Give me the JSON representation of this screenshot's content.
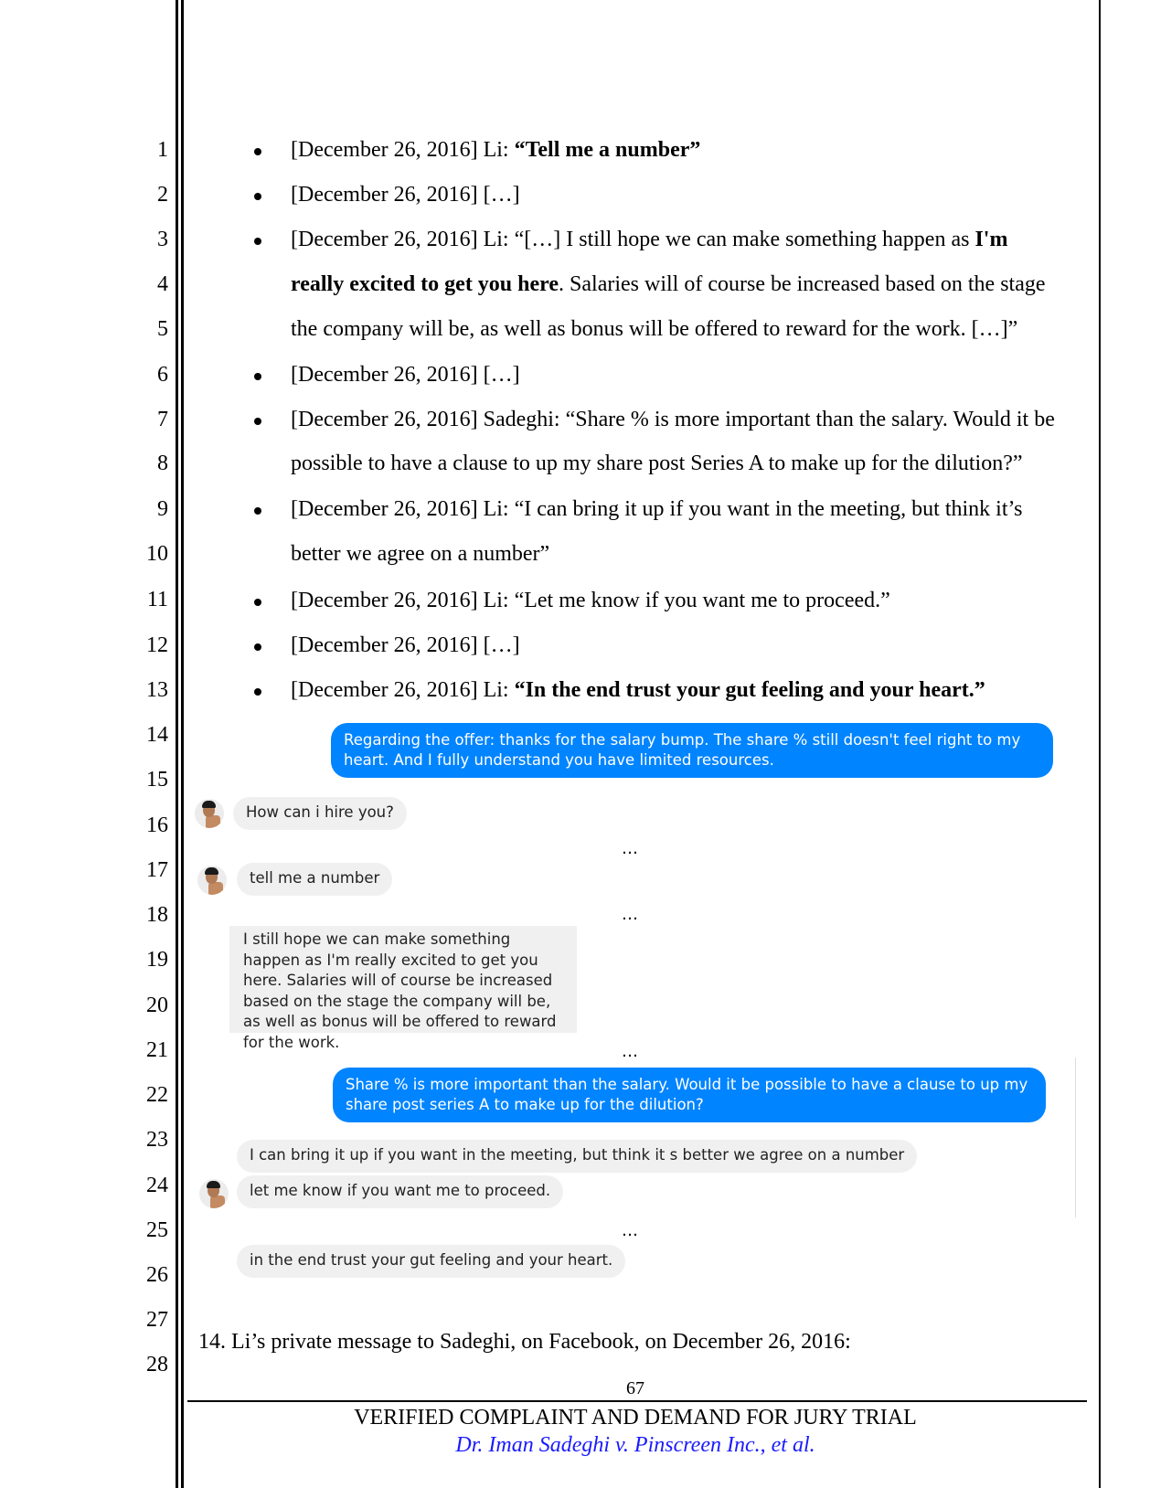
{
  "line_numbers": [
    "1",
    "2",
    "3",
    "4",
    "5",
    "6",
    "7",
    "8",
    "9",
    "10",
    "11",
    "12",
    "13",
    "14",
    "15",
    "16",
    "17",
    "18",
    "19",
    "20",
    "21",
    "22",
    "23",
    "24",
    "25",
    "26",
    "27",
    "28"
  ],
  "bullets": [
    {
      "date": "[December 26, 2016]",
      "speaker": " Li: ",
      "plain": "",
      "bold": "“Tell me a number”"
    },
    {
      "date": "[December 26, 2016]",
      "speaker": " […]",
      "plain": "",
      "bold": ""
    },
    {
      "date": "[December 26, 2016]",
      "speaker": " Li: ",
      "plain": "“[…] I still hope we can make something happen as ",
      "bold": "I'm",
      "cont1_bold": "really excited to get you here",
      "cont1_plain": ". Salaries will of course be increased based on the stage",
      "cont2_plain": "the company will be, as well as bonus will be offered to reward for the work. […]”"
    },
    {
      "date": "[December 26, 2016]",
      "speaker": " […]",
      "plain": "",
      "bold": ""
    },
    {
      "date": "[December 26, 2016]",
      "speaker": " Sadeghi: ",
      "plain": "“Share % is more important than the salary. Would it be",
      "bold": "",
      "cont1_plain": "possible to have a clause to up my share post Series A to make up for the dilution?”"
    },
    {
      "date": "[December 26, 2016]",
      "speaker": " Li: ",
      "plain": "“I can bring it up if you want in the meeting, but think it’s",
      "bold": "",
      "cont1_plain": "better we agree on a number”"
    },
    {
      "date": "[December 26, 2016]",
      "speaker": " Li: ",
      "plain": "“Let me know if you want me to proceed.”",
      "bold": ""
    },
    {
      "date": "[December 26, 2016]",
      "speaker": " […]",
      "plain": "",
      "bold": ""
    },
    {
      "date": "[December 26, 2016]",
      "speaker": " Li: ",
      "plain": "",
      "bold": "“In the end trust your gut feeling and your heart.”"
    }
  ],
  "chat": {
    "outgoing_1": "Regarding the offer: thanks for the salary bump. The share % still doesn't feel right to my heart. And I fully understand you have limited resources.",
    "incoming_1": "How can i hire you?",
    "incoming_2": "tell me a number",
    "incoming_3": "I still hope we can make something happen as I'm really excited to get you here. Salaries will of course be increased based on the stage the company will be, as well as bonus will be offered to reward for the work.",
    "outgoing_2": "Share % is more important than the salary. Would it be possible to have a clause to up my share post series A to make up for the dilution?",
    "incoming_4": "I can bring it up if you want in the meeting, but think it s better we agree on a number",
    "incoming_5": "let me know if you want me to proceed.",
    "incoming_6": "in the end trust your gut feeling and your heart.",
    "ellipsis": "…",
    "colors": {
      "outgoing": "#0084ff",
      "incoming": "#f0f0f0"
    }
  },
  "paragraph": "14. Li’s private message to Sadeghi, on Facebook, on December 26, 2016:",
  "footer": {
    "page_number": "67",
    "title": "VERIFIED COMPLAINT AND DEMAND FOR JURY TRIAL",
    "case": "Dr. Iman Sadeghi v. Pinscreen Inc., et al."
  }
}
